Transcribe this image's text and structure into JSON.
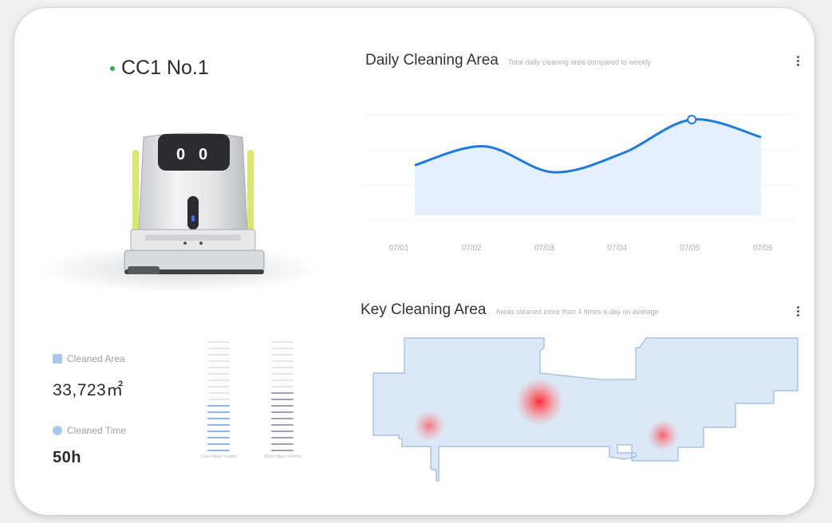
{
  "robot": {
    "name": "CC1 No.1",
    "status_color": "#27b24a"
  },
  "stats": {
    "area_label": "Cleaned Area",
    "area_value": "33,723㎡",
    "time_label": "Cleaned Time",
    "time_value": "50h"
  },
  "gauges": [
    {
      "label": "Clean Water Volume",
      "color": "#8ab7ea",
      "filled_fraction": 0.45
    },
    {
      "label": "Waste Water Volume",
      "color": "#9ea0b8",
      "filled_fraction": 0.55
    }
  ],
  "daily_chart": {
    "title": "Daily Cleaning Area",
    "subtitle": "Total daily cleaning area compared to weekly"
  },
  "key_area": {
    "title": "Key Cleaning Area",
    "subtitle": "Areas cleaned more than 4 times a day on average"
  },
  "chart_data": {
    "type": "area",
    "x": [
      "07/01",
      "07/02",
      "07/03",
      "07/04",
      "07/05",
      "07/06"
    ],
    "categories": [
      "07/01",
      "07/02",
      "07/03",
      "07/04",
      "07/05",
      "07/06"
    ],
    "values": [
      0.35,
      0.62,
      0.25,
      0.52,
      1.0,
      0.75
    ],
    "highlight_index": 4,
    "line_color": "#1f7be0",
    "fill_color": "#d9ebfb",
    "grid": true
  },
  "hotspots": [
    {
      "intensity": 1.0
    },
    {
      "intensity": 0.6
    },
    {
      "intensity": 0.7
    }
  ],
  "colors": {
    "accent": "#1f7be0",
    "map_fill": "#dbe8f6",
    "map_stroke": "#a9c3e3",
    "hotspot": "#ff2a2a"
  }
}
